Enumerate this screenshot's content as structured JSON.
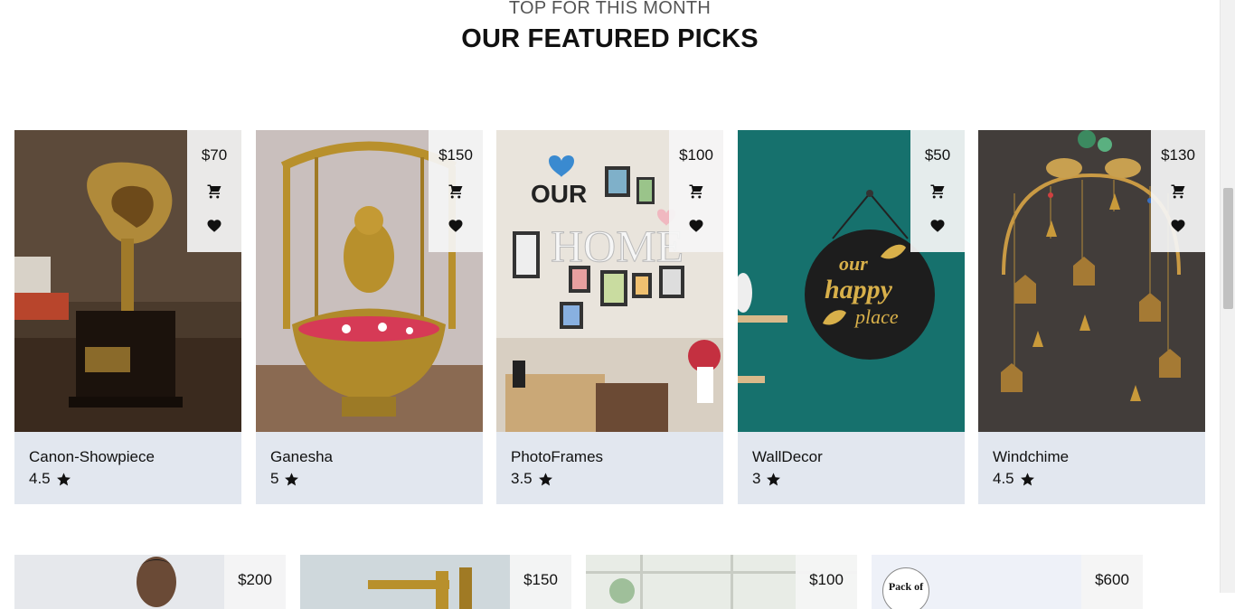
{
  "section": {
    "subtitle": "TOP FOR THIS MONTH",
    "title": "OUR FEATURED PICKS"
  },
  "icons": {
    "cart": "cart-icon",
    "heart": "heart-icon",
    "star": "star-icon"
  },
  "products": [
    {
      "name": "Canon-Showpiece",
      "price": "$70",
      "rating": "4.5"
    },
    {
      "name": "Ganesha",
      "price": "$150",
      "rating": "5"
    },
    {
      "name": "PhotoFrames",
      "price": "$100",
      "rating": "3.5"
    },
    {
      "name": "WallDecor",
      "price": "$50",
      "rating": "3"
    },
    {
      "name": "Windchime",
      "price": "$130",
      "rating": "4.5"
    }
  ],
  "next_row": [
    {
      "price": "$200"
    },
    {
      "price": "$150"
    },
    {
      "price": "$100"
    },
    {
      "price": "$600",
      "badge": "Pack of"
    }
  ]
}
